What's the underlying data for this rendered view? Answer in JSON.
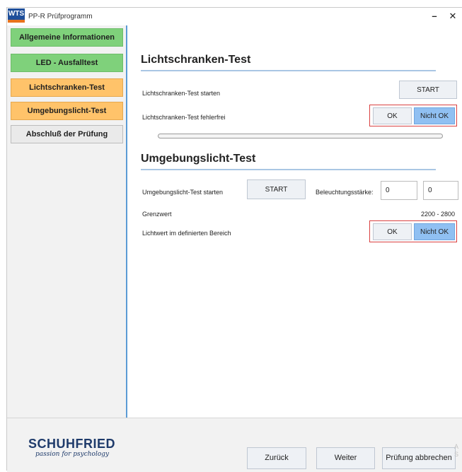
{
  "titlebar": {
    "logo_text": "WTS",
    "app_title": "PP-R Prüfprogramm",
    "minimize_symbol": "–",
    "close_symbol": "✕"
  },
  "sidebar": {
    "items": [
      {
        "label": "Allgemeine Informationen",
        "status": "green"
      },
      {
        "label": "LED - Ausfalltest",
        "status": "green"
      },
      {
        "label": "Lichtschranken-Test",
        "status": "orange"
      },
      {
        "label": "Umgebungslicht-Test",
        "status": "orange"
      },
      {
        "label": "Abschluß der Prüfung",
        "status": "grey"
      }
    ]
  },
  "lichtschranken": {
    "title": "Lichtschranken-Test",
    "start_label": "Lichtschranken-Test starten",
    "start_button": "START",
    "fehlerfrei_label": "Lichtschranken-Test fehlerfrei",
    "ok_button": "OK",
    "nicht_ok_button": "Nicht OK",
    "progress": 0
  },
  "umgebungslicht": {
    "title": "Umgebungslicht-Test",
    "start_label": "Umgebungslicht-Test starten",
    "start_button": "START",
    "beleuchtung_label": "Beleuchtungsstärke:",
    "value1": "0",
    "value2": "0",
    "grenzwert_label": "Grenzwert",
    "grenzwert_value": "2200 - 2800",
    "bereich_label": "Lichtwert im definierten Bereich",
    "ok_button": "OK",
    "nicht_ok_button": "Nicht OK"
  },
  "footer": {
    "brand": "SCHUHFRIED",
    "tagline": "passion for psychology",
    "back_button": "Zurück",
    "next_button": "Weiter",
    "cancel_button": "Prüfung abbrechen",
    "ghost_text": "A\nS"
  },
  "colors": {
    "green": "#7fd17b",
    "orange": "#ffc36a",
    "accent_blue": "#90c0f2",
    "highlight_red": "#d94040"
  }
}
